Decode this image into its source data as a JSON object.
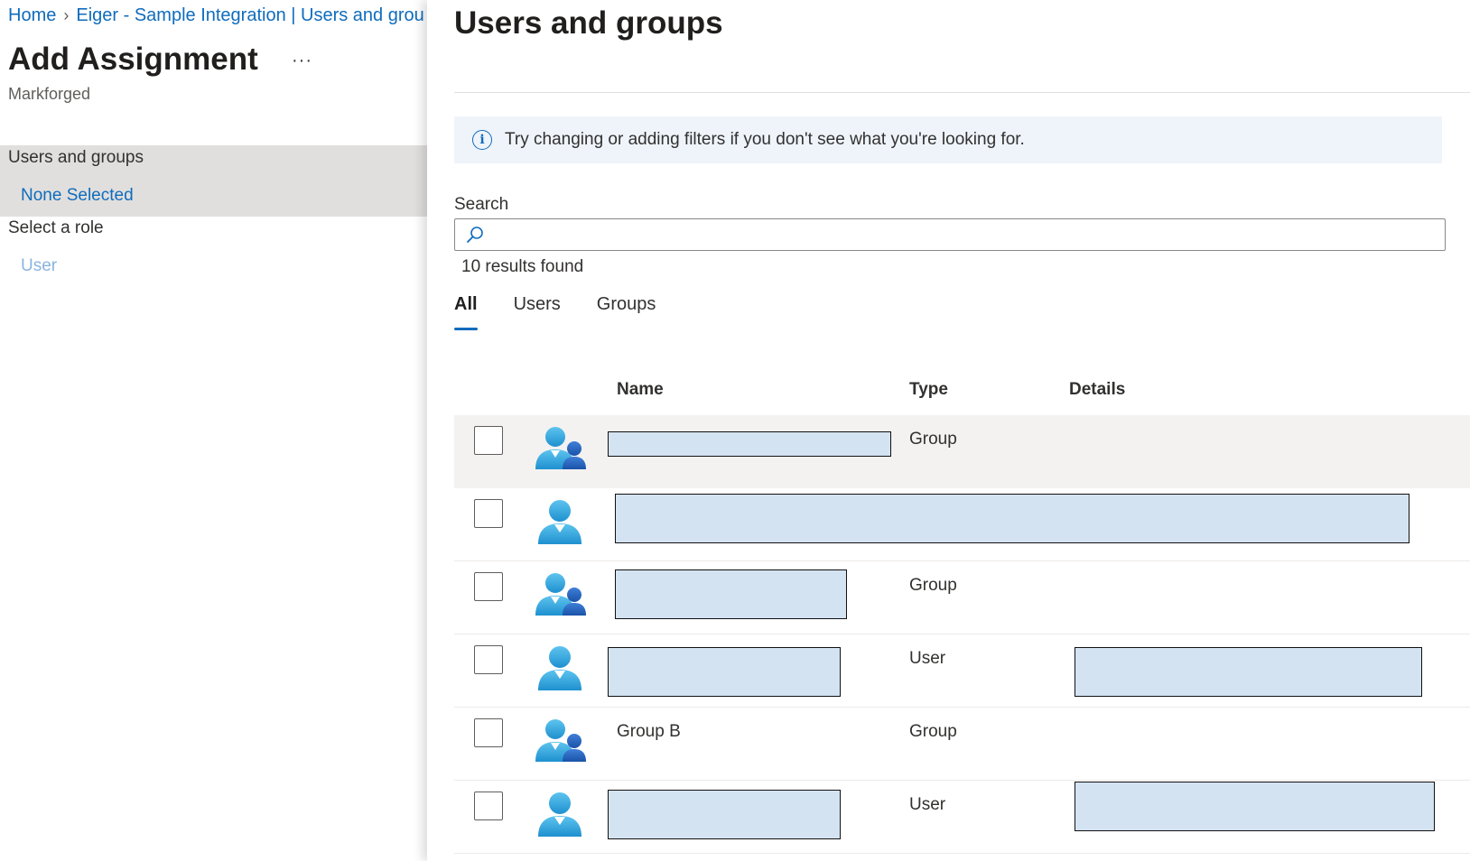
{
  "breadcrumb": {
    "home": "Home",
    "current": "Eiger - Sample Integration | Users and groups"
  },
  "left_blade": {
    "title": "Add Assignment",
    "more": "···",
    "subtitle": "Markforged",
    "users_groups": {
      "label": "Users and groups",
      "value": "None Selected"
    },
    "role": {
      "label": "Select a role",
      "value": "User"
    }
  },
  "panel": {
    "title": "Users and groups",
    "info": "Try changing or adding filters if you don't see what you're looking for.",
    "search": {
      "label": "Search",
      "value": "",
      "placeholder": ""
    },
    "results": "10 results found",
    "tabs": [
      "All",
      "Users",
      "Groups"
    ],
    "columns": {
      "name": "Name",
      "type": "Type",
      "details": "Details"
    },
    "rows": [
      {
        "avatar": "group-icon",
        "name": "",
        "type": "Group",
        "details": ""
      },
      {
        "avatar": "user-icon",
        "name": "",
        "type": "",
        "details": ""
      },
      {
        "avatar": "group-icon",
        "name": "",
        "type": "Group",
        "details": ""
      },
      {
        "avatar": "user-icon",
        "name": "",
        "type": "User",
        "details": ""
      },
      {
        "avatar": "group-icon",
        "name": "Group B",
        "type": "Group",
        "details": ""
      },
      {
        "avatar": "user-icon",
        "name": "",
        "type": "User",
        "details": ""
      }
    ]
  },
  "colors": {
    "accent": "#0f6cbd",
    "selected_bg": "#e1dfdd",
    "info_bg": "#eff4fb",
    "redaction_fill": "#d4e3f2"
  }
}
